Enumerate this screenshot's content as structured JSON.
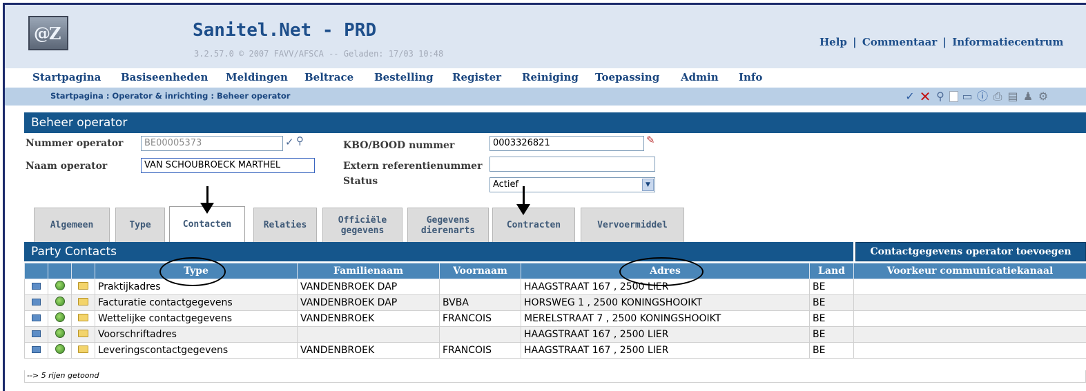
{
  "header": {
    "logo_text": "@Z",
    "title": "Sanitel.Net - PRD",
    "version": "3.2.57.0 © 2007 FAVV/AFSCA -- Geladen: 17/03 10:48",
    "links": [
      "Help",
      "Commentaar",
      "Informatiecentrum"
    ],
    "link_separator": "|"
  },
  "menu": [
    "Startpagina",
    "Basiseenheden",
    "Meldingen",
    "Beltrace",
    "Bestelling",
    "Register",
    "Reiniging",
    "Toepassing",
    "Admin",
    "Info"
  ],
  "breadcrumb": "Startpagina : Operator & inrichting : Beheer operator",
  "section_title": "Beheer operator",
  "form": {
    "nummer_label": "Nummer operator",
    "nummer_value": "BE00005373",
    "naam_label": "Naam operator",
    "naam_value": "VAN SCHOUBROECK MARTHEL",
    "kbo_label": "KBO/BOOD nummer",
    "kbo_value": "0003326821",
    "extern_label": "Extern referentienummer",
    "extern_value": "",
    "status_label": "Status",
    "status_value": "Actief"
  },
  "tabs": [
    {
      "label": "Algemeen"
    },
    {
      "label": "Type"
    },
    {
      "label": "Contacten"
    },
    {
      "label": "Relaties"
    },
    {
      "label": "Officiële gegevens"
    },
    {
      "label": "Gegevens dierenarts"
    },
    {
      "label": "Contracten"
    },
    {
      "label": "Vervoermiddel"
    }
  ],
  "grid": {
    "title": "Party Contacts",
    "add_button": "Contactgegevens operator toevoegen",
    "columns": [
      "Type",
      "Familienaam",
      "Voornaam",
      "Adres",
      "Land",
      "Voorkeur communicatiekanaal"
    ],
    "rows": [
      {
        "type": "Praktijkadres",
        "familienaam": "VANDENBROEK DAP",
        "voornaam": "",
        "adres": "HAAGSTRAAT 167 , 2500 LIER",
        "land": "BE",
        "kanaal": ""
      },
      {
        "type": "Facturatie contactgegevens",
        "familienaam": "VANDENBROEK DAP",
        "voornaam": "BVBA",
        "adres": "HORSWEG 1 , 2500 KONINGSHOOIKT",
        "land": "BE",
        "kanaal": ""
      },
      {
        "type": "Wettelijke contactgegevens",
        "familienaam": "VANDENBROEK",
        "voornaam": "FRANCOIS",
        "adres": "MERELSTRAAT 7 , 2500 KONINGSHOOIKT",
        "land": "BE",
        "kanaal": ""
      },
      {
        "type": "Voorschriftadres",
        "familienaam": "",
        "voornaam": "",
        "adres": "HAAGSTRAAT 167 , 2500 LIER",
        "land": "BE",
        "kanaal": ""
      },
      {
        "type": "Leveringscontactgegevens",
        "familienaam": "VANDENBROEK",
        "voornaam": "FRANCOIS",
        "adres": "HAAGSTRAAT 167 , 2500 LIER",
        "land": "BE",
        "kanaal": ""
      }
    ],
    "footer": "--> 5 rijen getoond"
  },
  "colors": {
    "accent": "#15568c",
    "header_bg": "#dde6f2",
    "grid_header": "#4a86b8"
  }
}
